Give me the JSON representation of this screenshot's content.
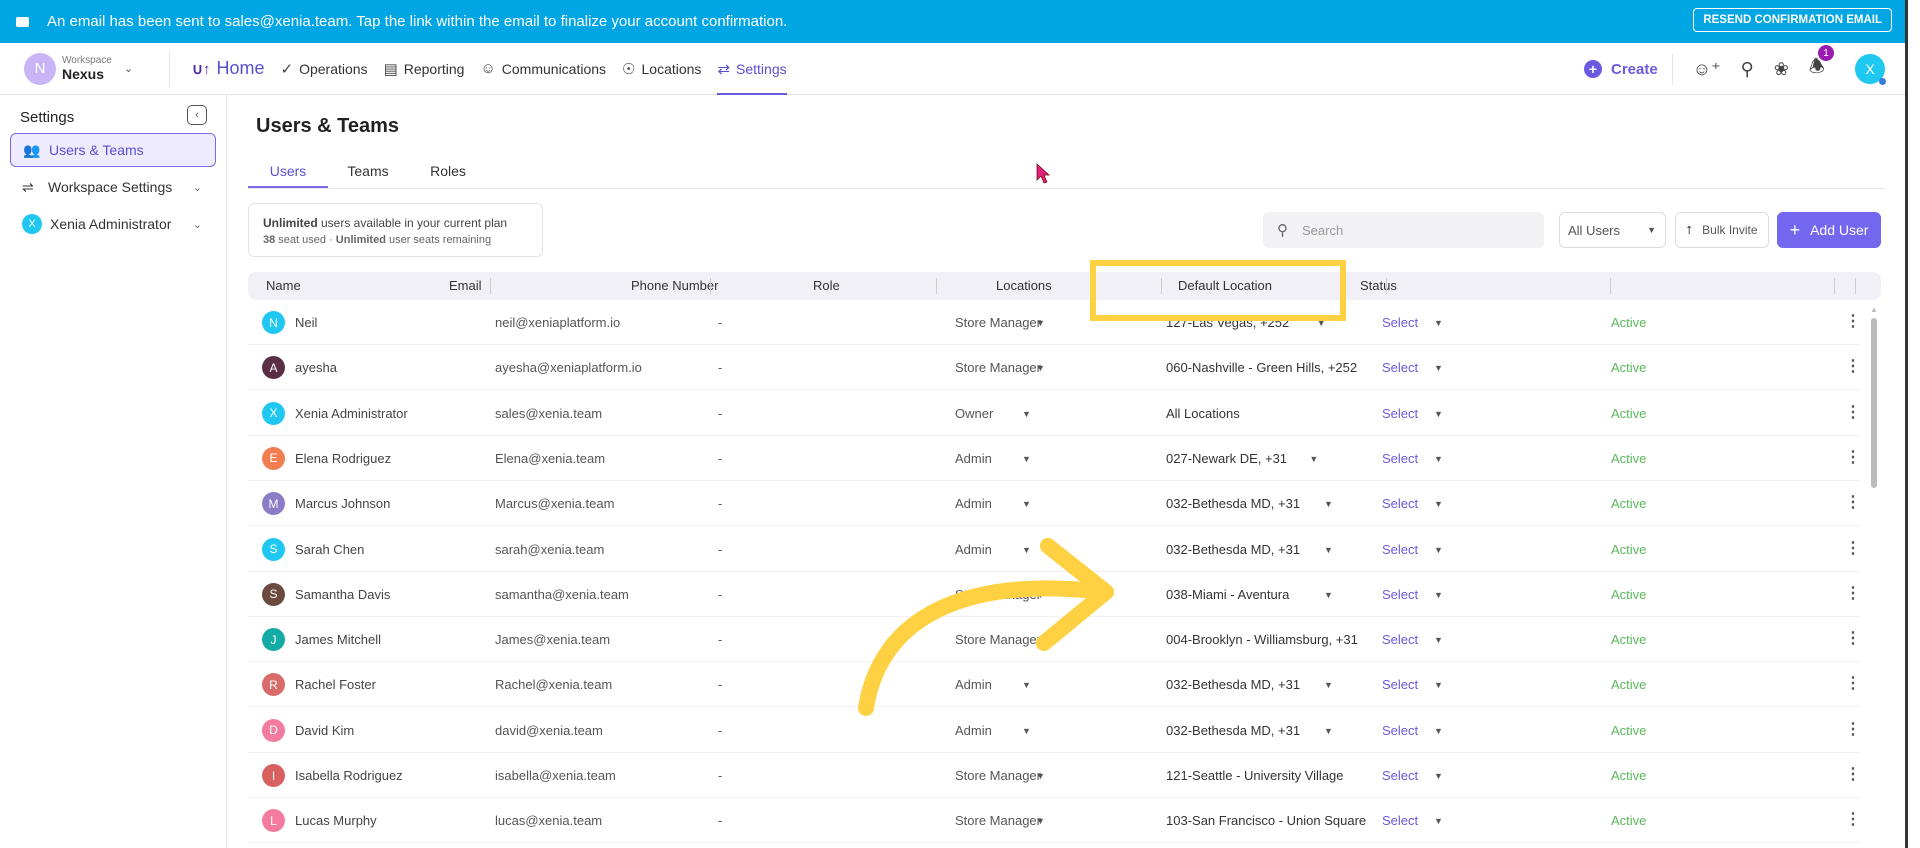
{
  "banner": {
    "message": "An email has been sent to sales@xenia.team. Tap the link within the email to finalize your account confirmation.",
    "resend": "RESEND CONFIRMATION EMAIL"
  },
  "workspace": {
    "label": "Workspace",
    "name": "Nexus",
    "initial": "N"
  },
  "nav": [
    {
      "label": "Home",
      "icon": "home-logo-icon",
      "active": false
    },
    {
      "label": "Operations",
      "icon": "check-circle-icon",
      "active": false
    },
    {
      "label": "Reporting",
      "icon": "presentation-chart-icon",
      "active": false
    },
    {
      "label": "Communications",
      "icon": "chat-icon",
      "active": false
    },
    {
      "label": "Locations",
      "icon": "map-pin-icon",
      "active": false
    },
    {
      "label": "Settings",
      "icon": "settings-sliders-icon",
      "active": true
    }
  ],
  "topright": {
    "create": "Create",
    "notifications": "1",
    "user_initial": "X"
  },
  "sidebar": {
    "title": "Settings",
    "items": [
      {
        "label": "Users & Teams",
        "active": true
      },
      {
        "label": "Workspace Settings"
      },
      {
        "label": "Xenia Administrator",
        "initial": "X"
      }
    ]
  },
  "page": {
    "title": "Users & Teams",
    "tabs": [
      "Users",
      "Teams",
      "Roles"
    ],
    "plan": {
      "bold1": "Unlimited",
      "text1": " users available in your current plan",
      "bold2": "38",
      "text2": " seat used · ",
      "bold3": "Unlimited",
      "text3": " user seats remaining"
    },
    "search_placeholder": "Search",
    "filter": "All Users",
    "bulk_invite": "Bulk Invite",
    "add_user": "Add User"
  },
  "columns": [
    "Name",
    "Email",
    "Phone Number",
    "Role",
    "Locations",
    "Default Location",
    "Status"
  ],
  "users": [
    {
      "initial": "N",
      "name": "Neil",
      "email": "neil@xeniaplatform.io",
      "phone": "-",
      "role": "Store Manager",
      "location": "127-Las Vegas, +252",
      "loc_caret": true,
      "default": "Select",
      "status": "Active",
      "color": "#1ec8f0"
    },
    {
      "initial": "A",
      "name": "ayesha",
      "email": "ayesha@xeniaplatform.io",
      "phone": "-",
      "role": "Store Manager",
      "location": "060-Nashville - Green Hills, +252",
      "loc_caret": false,
      "default": "Select",
      "status": "Active",
      "color": "#5a2f45"
    },
    {
      "initial": "X",
      "name": "Xenia Administrator",
      "email": "sales@xenia.team",
      "phone": "-",
      "role": "Owner",
      "location": "All Locations",
      "loc_caret": false,
      "default": "Select",
      "status": "Active",
      "color": "#1ec8f0"
    },
    {
      "initial": "E",
      "name": "Elena Rodriguez",
      "email": "Elena@xenia.team",
      "phone": "-",
      "role": "Admin",
      "location": "027-Newark DE, +31",
      "loc_caret": true,
      "default": "Select",
      "status": "Active",
      "color": "#f07e50"
    },
    {
      "initial": "M",
      "name": "Marcus Johnson",
      "email": "Marcus@xenia.team",
      "phone": "-",
      "role": "Admin",
      "location": "032-Bethesda MD, +31",
      "loc_caret": true,
      "default": "Select",
      "status": "Active",
      "color": "#8a7cc6"
    },
    {
      "initial": "S",
      "name": "Sarah Chen",
      "email": "sarah@xenia.team",
      "phone": "-",
      "role": "Admin",
      "location": "032-Bethesda MD, +31",
      "loc_caret": true,
      "default": "Select",
      "status": "Active",
      "color": "#1ec8f0"
    },
    {
      "initial": "S",
      "name": "Samantha Davis",
      "email": "samantha@xenia.team",
      "phone": "-",
      "role": "Store Manager",
      "location": "038-Miami - Aventura",
      "loc_caret": true,
      "default": "Select",
      "status": "Active",
      "color": "#6b4a3f"
    },
    {
      "initial": "J",
      "name": "James Mitchell",
      "email": "James@xenia.team",
      "phone": "-",
      "role": "Store Manager",
      "location": "004-Brooklyn - Williamsburg, +31",
      "loc_caret": false,
      "default": "Select",
      "status": "Active",
      "color": "#14aaa6"
    },
    {
      "initial": "R",
      "name": "Rachel Foster",
      "email": "Rachel@xenia.team",
      "phone": "-",
      "role": "Admin",
      "location": "032-Bethesda MD, +31",
      "loc_caret": true,
      "default": "Select",
      "status": "Active",
      "color": "#d96b6b"
    },
    {
      "initial": "D",
      "name": "David Kim",
      "email": "david@xenia.team",
      "phone": "-",
      "role": "Admin",
      "location": "032-Bethesda MD, +31",
      "loc_caret": true,
      "default": "Select",
      "status": "Active",
      "color": "#f47ba0"
    },
    {
      "initial": "I",
      "name": "Isabella Rodriguez",
      "email": "isabella@xenia.team",
      "phone": "-",
      "role": "Store Manager",
      "location": "121-Seattle - University Village",
      "loc_caret": false,
      "default": "Select",
      "status": "Active",
      "color": "#d86060"
    },
    {
      "initial": "L",
      "name": "Lucas Murphy",
      "email": "lucas@xenia.team",
      "phone": "-",
      "role": "Store Manager",
      "location": "103-San Francisco - Union Square",
      "loc_caret": false,
      "default": "Select",
      "status": "Active",
      "color": "#f47ba0"
    }
  ],
  "colors": {
    "accent": "#6a5ae0",
    "banner": "#00a5e3",
    "highlight": "#fdd142",
    "active": "#5cb85c"
  }
}
